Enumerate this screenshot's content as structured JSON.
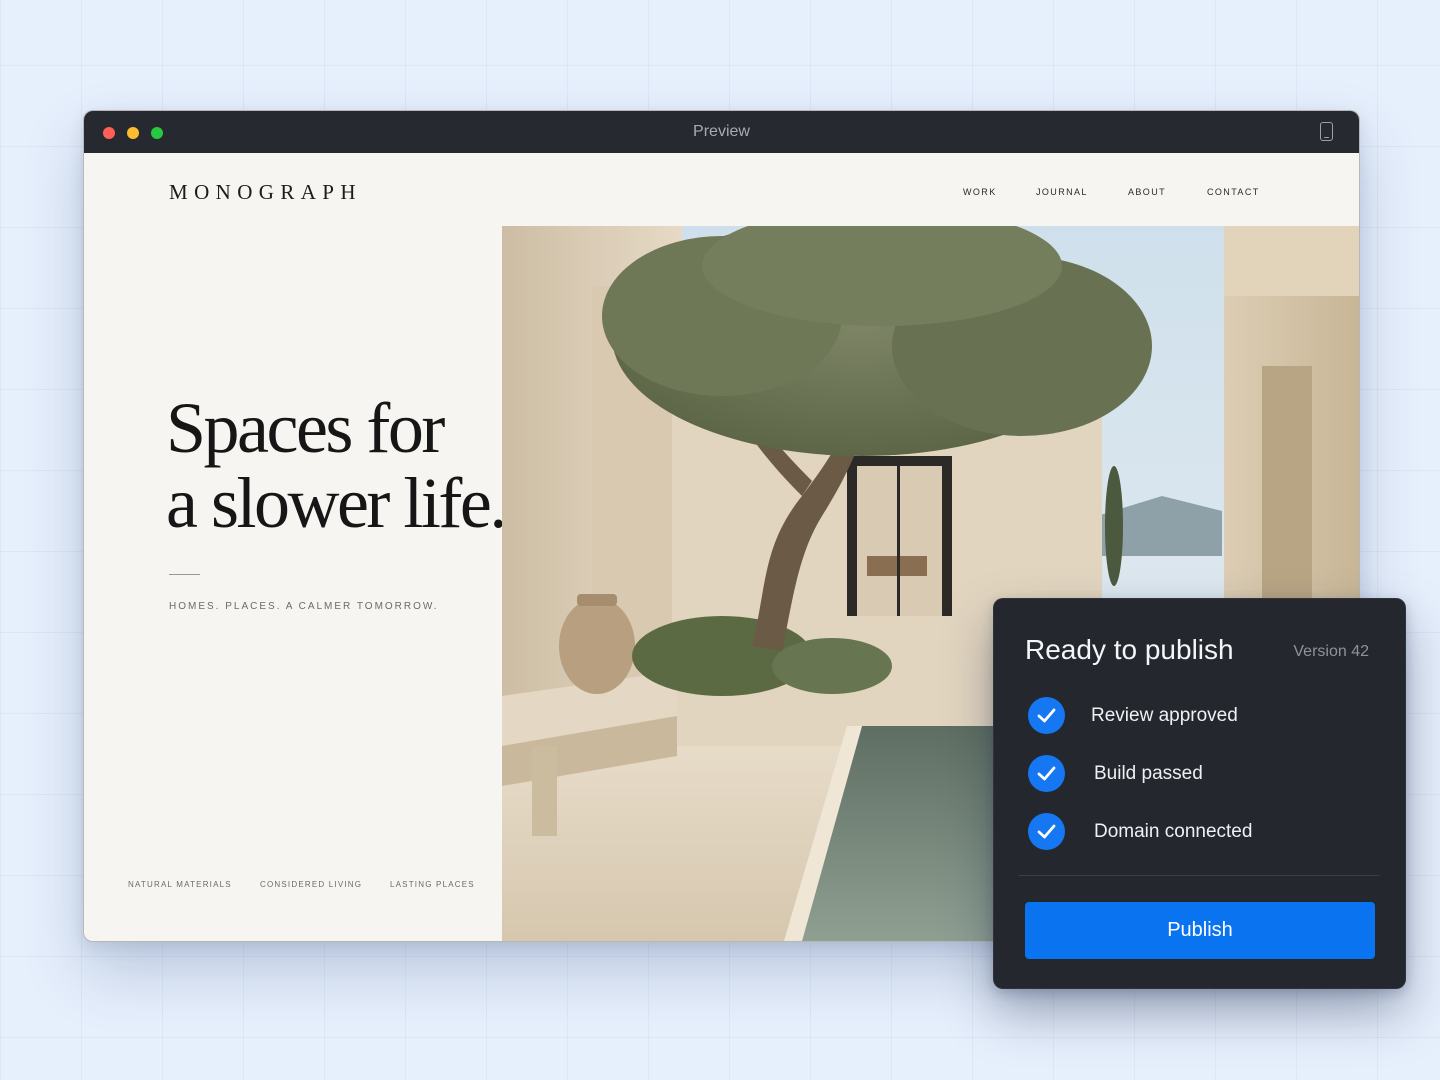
{
  "window": {
    "title": "Preview",
    "device_icon": "mobile-device-icon"
  },
  "site": {
    "logo": "MONOGRAPH",
    "nav": [
      "WORK",
      "JOURNAL",
      "ABOUT",
      "CONTACT"
    ],
    "headline": [
      "Spaces for",
      "a slower life."
    ],
    "tagline": "HOMES. PLACES. A CALMER TOMORROW.",
    "features": [
      "NATURAL MATERIALS",
      "CONSIDERED LIVING",
      "LASTING PLACES"
    ]
  },
  "publish_panel": {
    "title": "Ready to publish",
    "version": "Version 42",
    "checks": [
      {
        "label": "Review approved",
        "icon": "checkmark-icon"
      },
      {
        "label": "Build passed",
        "icon": "checkmark-icon"
      },
      {
        "label": "Domain connected",
        "icon": "checkmark-icon"
      }
    ],
    "publish_label": "Publish"
  },
  "colors": {
    "accent": "#0a74f0",
    "panel_background": "#24272d",
    "page_background": "#e6effc"
  }
}
